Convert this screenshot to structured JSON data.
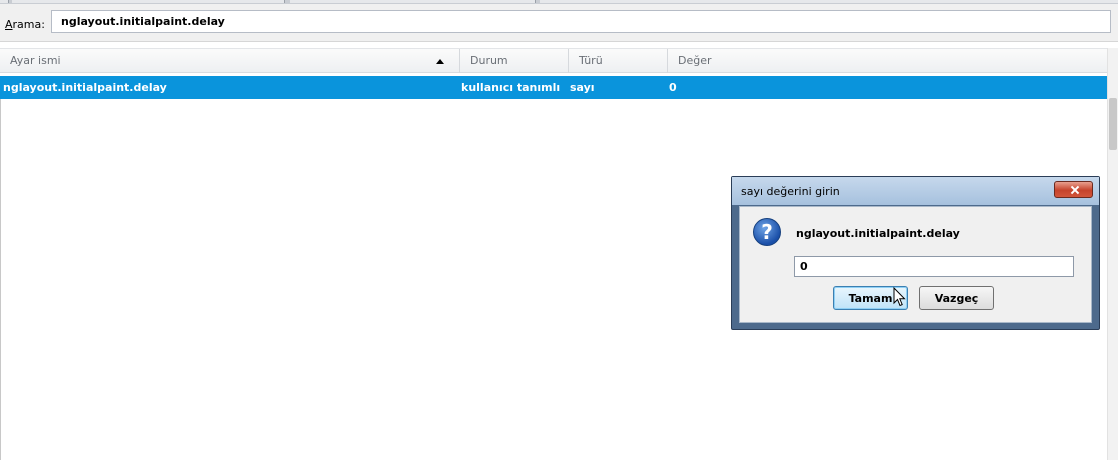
{
  "search": {
    "label_accel": "A",
    "label_rest": "rama:",
    "value": "nglayout.initialpaint.delay"
  },
  "columns": [
    {
      "label": "Ayar ismi"
    },
    {
      "label": "Durum"
    },
    {
      "label": "Türü"
    },
    {
      "label": "Değer"
    }
  ],
  "rows": [
    {
      "name": "nglayout.initialpaint.delay",
      "status": "kullanıcı tanımlı",
      "type": "sayı",
      "value": "0"
    }
  ],
  "dialog": {
    "title": "sayı değerini girin",
    "message": "nglayout.initialpaint.delay",
    "input_value": "0",
    "ok_label": "Tamam",
    "cancel_label": "Vazgeç"
  },
  "colors": {
    "selection": "#0a94dc",
    "dialog_frame": "#4d6a8c",
    "close_button": "#c6432c"
  }
}
